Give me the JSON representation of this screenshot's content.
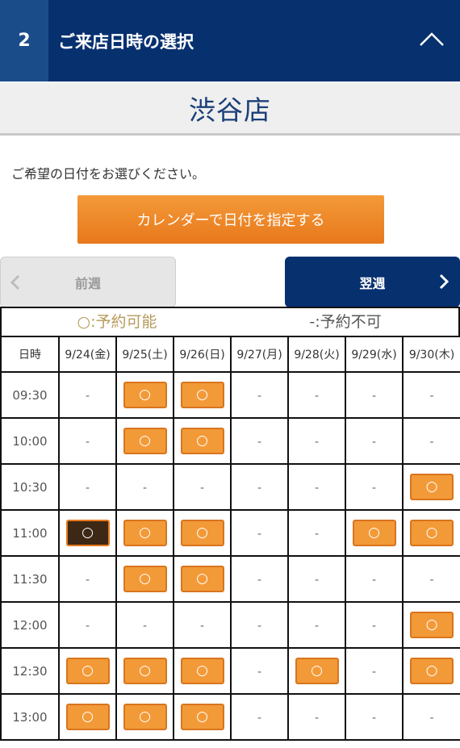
{
  "header": {
    "step": "2",
    "title": "ご来店日時の選択"
  },
  "store": {
    "name": "渋谷店"
  },
  "prompt": "ご希望の日付をお選びください。",
  "calendar_button": "カレンダーで日付を指定する",
  "nav": {
    "prev_label": "前週",
    "next_label": "翌週"
  },
  "legend": {
    "available": "○:予約可能",
    "unavailable": "-:予約不可"
  },
  "table": {
    "time_header": "日時",
    "days": [
      {
        "label": "9/24(金)",
        "kind": "weekday"
      },
      {
        "label": "9/25(土)",
        "kind": "sat"
      },
      {
        "label": "9/26(日)",
        "kind": "sun"
      },
      {
        "label": "9/27(月)",
        "kind": "weekday"
      },
      {
        "label": "9/28(火)",
        "kind": "weekday"
      },
      {
        "label": "9/29(水)",
        "kind": "weekday"
      },
      {
        "label": "9/30(木)",
        "kind": "weekday"
      }
    ],
    "rows": [
      {
        "time": "09:30",
        "slots": [
          "-",
          "○",
          "○",
          "-",
          "-",
          "-",
          "-"
        ]
      },
      {
        "time": "10:00",
        "slots": [
          "-",
          "○",
          "○",
          "-",
          "-",
          "-",
          "-"
        ]
      },
      {
        "time": "10:30",
        "slots": [
          "-",
          "-",
          "-",
          "-",
          "-",
          "-",
          "○"
        ]
      },
      {
        "time": "11:00",
        "slots": [
          "●",
          "○",
          "○",
          "-",
          "-",
          "○",
          "○"
        ]
      },
      {
        "time": "11:30",
        "slots": [
          "-",
          "○",
          "○",
          "-",
          "-",
          "-",
          "-"
        ]
      },
      {
        "time": "12:00",
        "slots": [
          "-",
          "-",
          "-",
          "-",
          "-",
          "-",
          "○"
        ]
      },
      {
        "time": "12:30",
        "slots": [
          "○",
          "○",
          "○",
          "-",
          "○",
          "-",
          "○"
        ]
      },
      {
        "time": "13:00",
        "slots": [
          "○",
          "○",
          "○",
          "-",
          "-",
          "-",
          "-"
        ]
      }
    ],
    "available_symbol": "○",
    "unavailable_symbol": "-"
  },
  "colors": {
    "header_bg": "#07306f",
    "accent_orange": "#f39a38",
    "selected_slot": "#3d2816",
    "saturday": "#2845a5",
    "sunday": "#e8302c"
  }
}
